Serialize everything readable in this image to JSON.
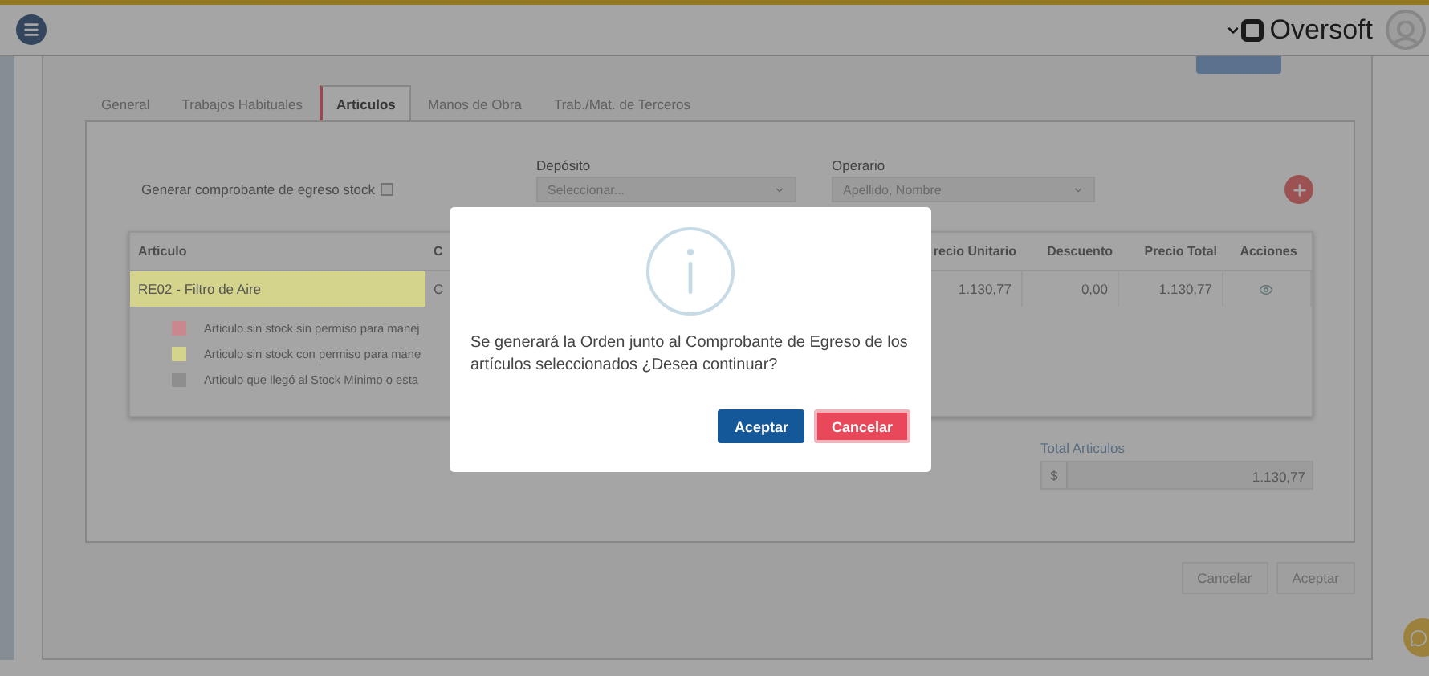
{
  "header": {
    "brand": "Oversoft"
  },
  "tabs": [
    {
      "label": "General",
      "selected": false
    },
    {
      "label": "Trabajos Habituales",
      "selected": false
    },
    {
      "label": "Articulos",
      "selected": true
    },
    {
      "label": "Manos de Obra",
      "selected": false
    },
    {
      "label": "Trab./Mat. de Terceros",
      "selected": false
    }
  ],
  "stock_voucher": {
    "label": "Generar comprobante de egreso stock",
    "checked": false
  },
  "deposito": {
    "label": "Depósito",
    "placeholder": "Seleccionar..."
  },
  "operario": {
    "label": "Operario",
    "placeholder": "Apellido, Nombre"
  },
  "table": {
    "columns": [
      "Articulo",
      "C",
      "recio Unitario",
      "Descuento",
      "Precio Total",
      "Acciones"
    ],
    "rows": [
      {
        "cells": [
          "RE02 - Filtro de Aire",
          "C",
          "1.130,77",
          "0,00",
          "1.130,77"
        ],
        "color": "#d5d48c"
      }
    ]
  },
  "legend": [
    {
      "text": "Articulo sin stock sin permiso para manej",
      "color": "#c8888d"
    },
    {
      "text": "Articulo sin stock con permiso para mane",
      "color": "#d5d48c"
    },
    {
      "text": "Articulo que llegó al Stock Mínimo o esta",
      "color": "#8e8e8e"
    }
  ],
  "total": {
    "label": "Total Articulos",
    "currency": "$",
    "value": "1.130,77"
  },
  "footer_buttons": [
    "Cancelar",
    "Aceptar"
  ],
  "dialog": {
    "message": "Se generará la Orden junto al Comprobante de Egreso de los artículos seleccionados ¿Desea continuar?",
    "buttons": [
      {
        "label": "Aceptar",
        "kind": "primary"
      },
      {
        "label": "Cancelar",
        "kind": "danger"
      }
    ]
  }
}
